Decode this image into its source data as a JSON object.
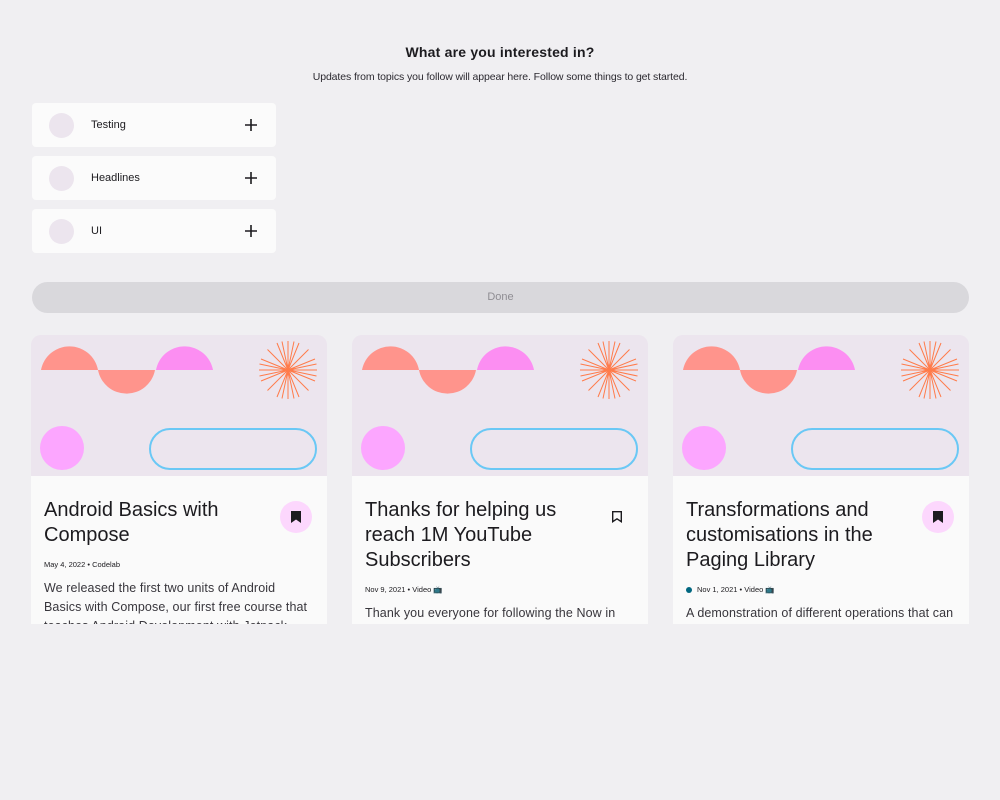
{
  "header": {
    "title": "What are you interested in?",
    "subtitle": "Updates from topics you follow will appear here. Follow some things to get started."
  },
  "topics": [
    {
      "label": "Testing"
    },
    {
      "label": "Headlines"
    },
    {
      "label": "UI"
    }
  ],
  "done_label": "Done",
  "cards": [
    {
      "title": "Android Basics with Compose",
      "meta": "May 4, 2022 • Codelab",
      "description": "We released the first two units of Android Basics with Compose, our first free course that teaches Android Development with Jetpack Compose.",
      "bookmarked": true,
      "unread_dot": false
    },
    {
      "title": "Thanks for helping us reach 1M YouTube Subscribers",
      "meta": "Nov 9, 2021 • Video 📺",
      "description": "Thank you everyone for following the Now in Android series and everything Android Developers.",
      "bookmarked": false,
      "unread_dot": false
    },
    {
      "title": "Transformations and customisations in the Paging Library",
      "meta": "Nov 1, 2021 • Video 📺",
      "description": "A demonstration of different operations that can be performed with Paging.",
      "bookmarked": true,
      "unread_dot": true
    }
  ],
  "colors": {
    "background": "#f0eff2",
    "card": "#fafafa",
    "art_background": "#ece5ee",
    "bookmark_bg": "#fcd7fd",
    "done_button": "#d9d8dc",
    "unread_dot": "#006780"
  }
}
